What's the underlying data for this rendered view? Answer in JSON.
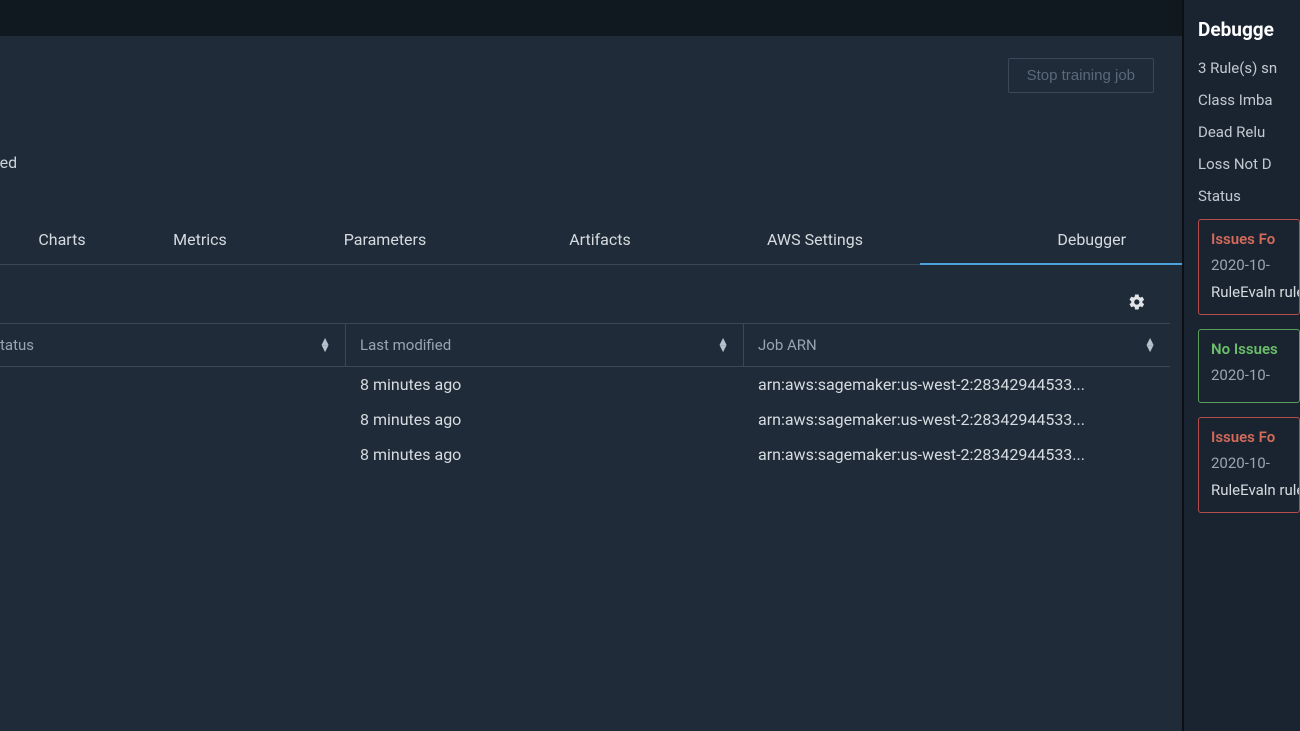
{
  "header": {
    "stop_button": "Stop training job",
    "status_text": "leted"
  },
  "tabs": {
    "charts": "Charts",
    "metrics": "Metrics",
    "parameters": "Parameters",
    "artifacts": "Artifacts",
    "aws_settings": "AWS Settings",
    "debugger": "Debugger"
  },
  "table": {
    "columns": {
      "status": "tatus",
      "last_modified": "Last modified",
      "job_arn": "Job ARN"
    },
    "rows": [
      {
        "status": "",
        "last_modified": "8 minutes ago",
        "job_arn": "arn:aws:sagemaker:us-west-2:28342944533..."
      },
      {
        "status": "",
        "last_modified": "8 minutes ago",
        "job_arn": "arn:aws:sagemaker:us-west-2:28342944533..."
      },
      {
        "status": "",
        "last_modified": "8 minutes ago",
        "job_arn": "arn:aws:sagemaker:us-west-2:28342944533..."
      }
    ]
  },
  "sidebar": {
    "title": "Debugge",
    "summary": "3 Rule(s) sn",
    "rules": [
      "Class Imba",
      "Dead Relu",
      "Loss Not D"
    ],
    "status_label": "Status",
    "cards": [
      {
        "type": "red",
        "title": "Issues Fo",
        "date": "2020-10-",
        "body": "RuleEvaln rule Class the cond"
      },
      {
        "type": "green",
        "title": "No Issues",
        "date": "2020-10-",
        "body": ""
      },
      {
        "type": "red",
        "title": "Issues Fo",
        "date": "2020-10-",
        "body": "RuleEvaln rule Loss in the co"
      }
    ]
  }
}
